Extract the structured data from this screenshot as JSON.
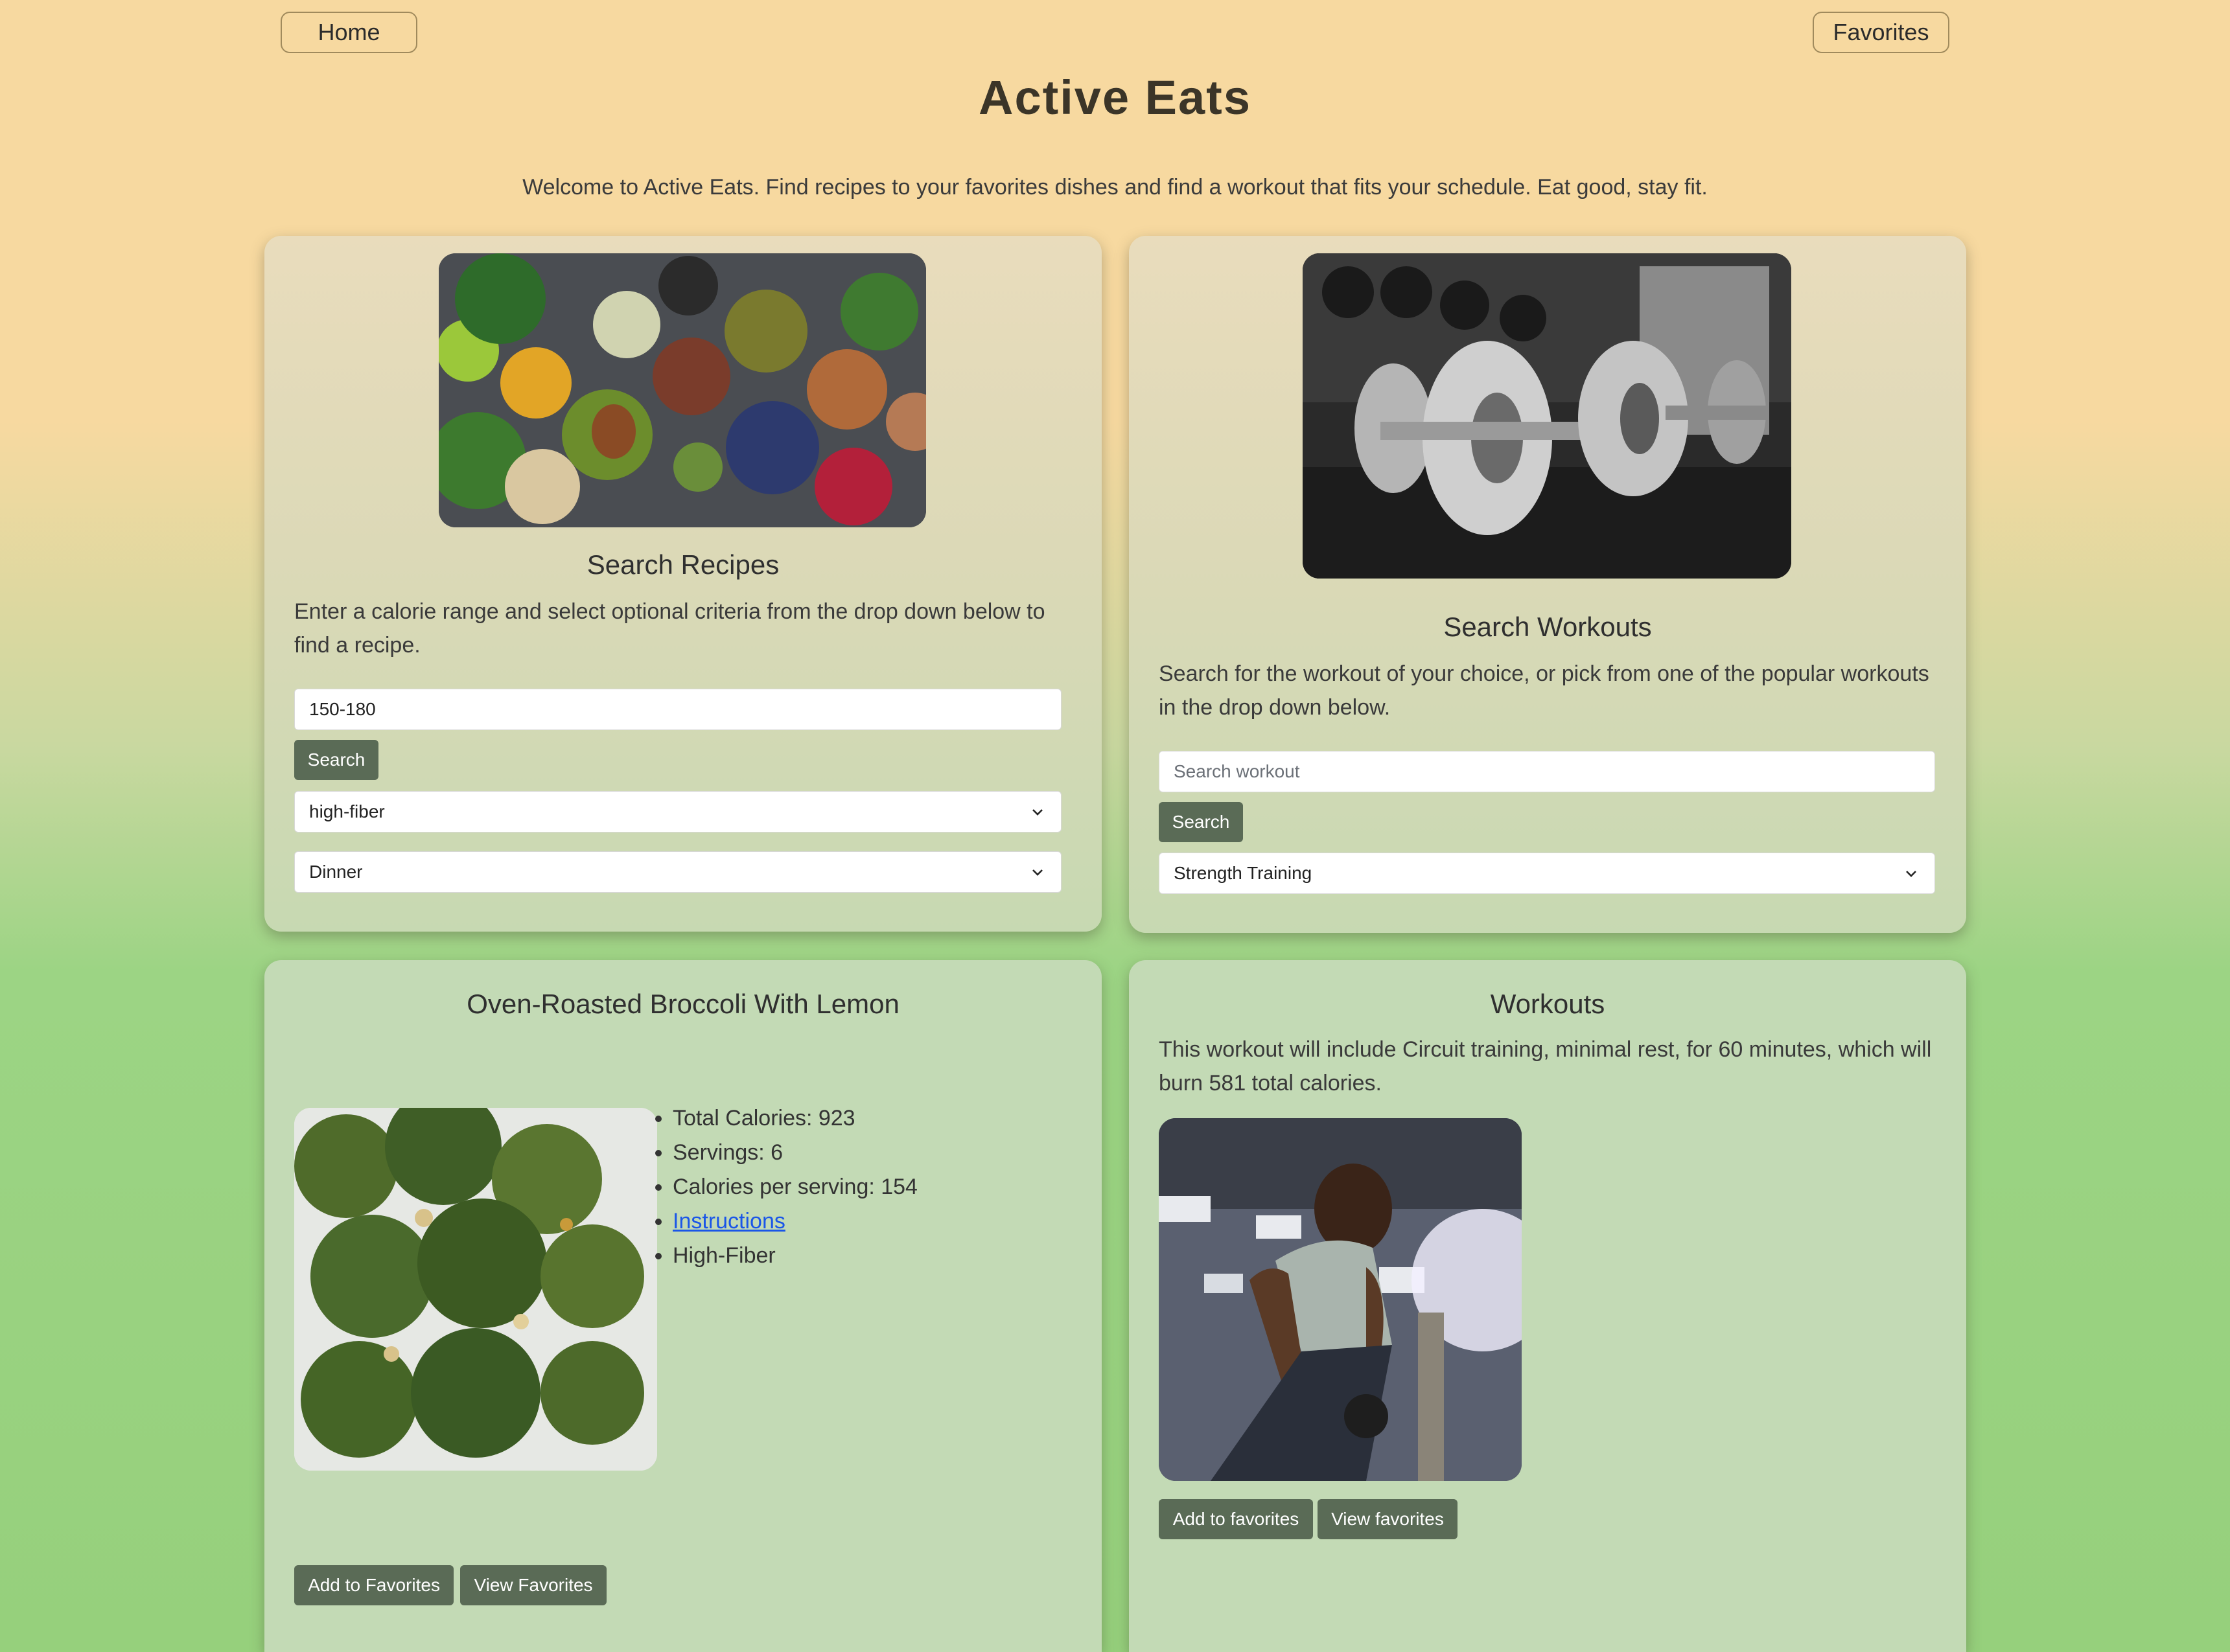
{
  "nav": {
    "home_label": "Home",
    "favorites_label": "Favorites"
  },
  "header": {
    "title": "Active Eats",
    "welcome": "Welcome to Active Eats. Find recipes to your favorites dishes and find a workout that fits your schedule. Eat good, stay fit."
  },
  "recipes_search": {
    "heading": "Search Recipes",
    "description": "Enter a calorie range and select optional criteria from the drop down below to find a recipe.",
    "calorie_value": "150-180",
    "search_label": "Search",
    "diet_selected": "high-fiber",
    "meal_selected": "Dinner"
  },
  "workouts_search": {
    "heading": "Search Workouts",
    "description": "Search for the workout of your choice, or pick from one of the popular workouts in the drop down below.",
    "input_placeholder": "Search workout",
    "search_label": "Search",
    "workout_selected": "Strength Training"
  },
  "recipe_result": {
    "title": "Oven-Roasted Broccoli With Lemon",
    "facts": [
      "Total Calories: 923",
      "Servings: 6",
      "Calories per serving: 154",
      "Instructions",
      "High-Fiber"
    ],
    "add_label": "Add to Favorites",
    "view_label": "View Favorites"
  },
  "workout_result": {
    "heading": "Workouts",
    "description": "This workout will include Circuit training, minimal rest, for 60 minutes, which will burn 581 total calories.",
    "add_label": "Add to favorites",
    "view_label": "View favorites"
  },
  "icons": {
    "select_arrow": "chevron-down-icon"
  },
  "colors": {
    "button": "#5a6b56",
    "link": "#1a56e8",
    "top_bg": "#f7d9a0",
    "bottom_bg": "#96d07c"
  }
}
